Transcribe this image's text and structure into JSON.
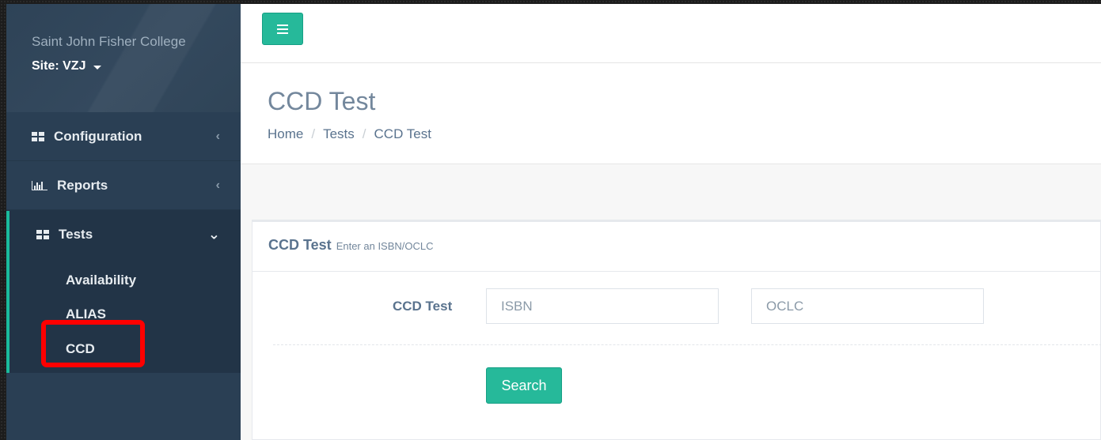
{
  "sidebar": {
    "college_name": "Saint John Fisher College",
    "site_label": "Site: VZJ",
    "menu": [
      {
        "label": "Configuration",
        "icon": "grid-icon",
        "chevron": "‹"
      },
      {
        "label": "Reports",
        "icon": "bar-chart-icon",
        "chevron": "‹"
      },
      {
        "label": "Tests",
        "icon": "grid-icon",
        "chevron": "⌄"
      }
    ],
    "tests_submenu": [
      "Availability",
      "ALIAS",
      "CCD"
    ],
    "accent_color": "#1abb9c",
    "highlight_color": "#ff0000"
  },
  "header": {
    "toggle_icon": "hamburger-icon"
  },
  "page": {
    "title": "CCD Test",
    "breadcrumb": [
      "Home",
      "Tests",
      "CCD Test"
    ],
    "breadcrumb_separator": "/"
  },
  "panel": {
    "title": "CCD Test",
    "subtitle": "Enter an ISBN/OCLC",
    "form_label": "CCD Test",
    "isbn_placeholder": "ISBN",
    "oclc_placeholder": "OCLC",
    "search_label": "Search",
    "button_color": "#26b99a"
  }
}
